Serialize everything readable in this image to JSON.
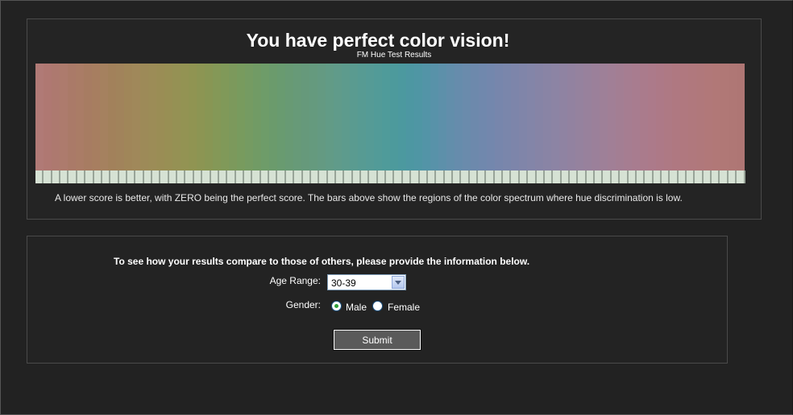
{
  "results": {
    "title": "You have perfect color vision!",
    "subtitle": "FM Hue Test Results",
    "explanation": "A lower score is better, with ZERO being the perfect score. The bars above show the regions of the color spectrum where hue discrimination is low.",
    "spectrum_colors": [
      "#b07a76",
      "#af7872",
      "#ad796f",
      "#ad7b6d",
      "#aa7a68",
      "#aa7c66",
      "#a77c62",
      "#a77e60",
      "#a5815f",
      "#a2815b",
      "#a1835b",
      "#a08659",
      "#a0885a",
      "#9d8a58",
      "#9c8c57",
      "#9a8d55",
      "#988f54",
      "#959154",
      "#939353",
      "#909452",
      "#8c9553",
      "#889654",
      "#849857",
      "#809959",
      "#7c995c",
      "#789b5e",
      "#759b62",
      "#719b65",
      "#6e9c69",
      "#6b9b6c",
      "#699b70",
      "#689a74",
      "#679a78",
      "#66997b",
      "#659a7e",
      "#649a82",
      "#629b86",
      "#609b8a",
      "#5d9b8d",
      "#5a9b90",
      "#579b93",
      "#559b96",
      "#529b98",
      "#4f9b9a",
      "#4d9a9c",
      "#4c999f",
      "#4d97a2",
      "#4f96a4",
      "#5394a7",
      "#5892a9",
      "#5d90aa",
      "#628eab",
      "#668cac",
      "#6a8bac",
      "#6d89ac",
      "#7088ad",
      "#7387ad",
      "#7786ac",
      "#7a86ab",
      "#7d85aa",
      "#8085a9",
      "#8385a8",
      "#8684a6",
      "#8984a5",
      "#8c84a4",
      "#8f83a2",
      "#9282a0",
      "#95829e",
      "#98819c",
      "#9b809a",
      "#9e8098",
      "#a17f96",
      "#a37e93",
      "#a67d91",
      "#a87c8f",
      "#aa7b8c",
      "#ac7a8a",
      "#ad7987",
      "#ae7984",
      "#af7881",
      "#b0787f",
      "#b0787d",
      "#b0787b",
      "#b17879",
      "#b17877",
      "#b07876",
      "#af7775",
      "#ae7674"
    ],
    "score_cell_count": 85
  },
  "form": {
    "intro": "To see how your results compare to those of others, please provide the information below.",
    "age_label": "Age Range:",
    "age_value": "30-39",
    "gender_label": "Gender:",
    "gender_options": {
      "male": "Male",
      "female": "Female"
    },
    "gender_selected": "male",
    "submit_label": "Submit"
  }
}
